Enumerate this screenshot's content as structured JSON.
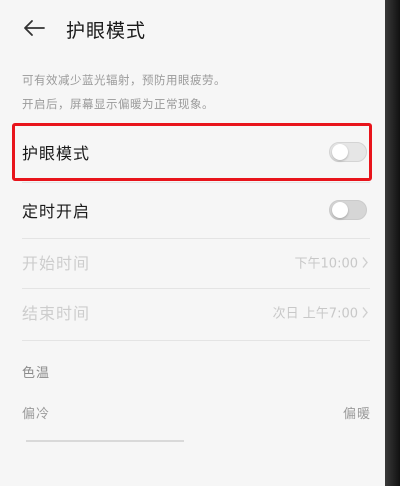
{
  "header": {
    "title": "护眼模式"
  },
  "description": {
    "line1": "可有效减少蓝光辐射，预防用眼疲劳。",
    "line2": "开启后，屏幕显示偏暖为正常现象。"
  },
  "eye_comfort": {
    "label": "护眼模式",
    "enabled": false
  },
  "scheduled": {
    "label": "定时开启",
    "enabled": false
  },
  "start_time": {
    "label": "开始时间",
    "value": "下午10:00"
  },
  "end_time": {
    "label": "结束时间",
    "value": "次日 上午7:00"
  },
  "color_temp": {
    "section_label": "色温",
    "cool_label": "偏冷",
    "warm_label": "偏暖"
  },
  "colors": {
    "highlight": "#e8141b",
    "background": "#f6f6f6"
  }
}
